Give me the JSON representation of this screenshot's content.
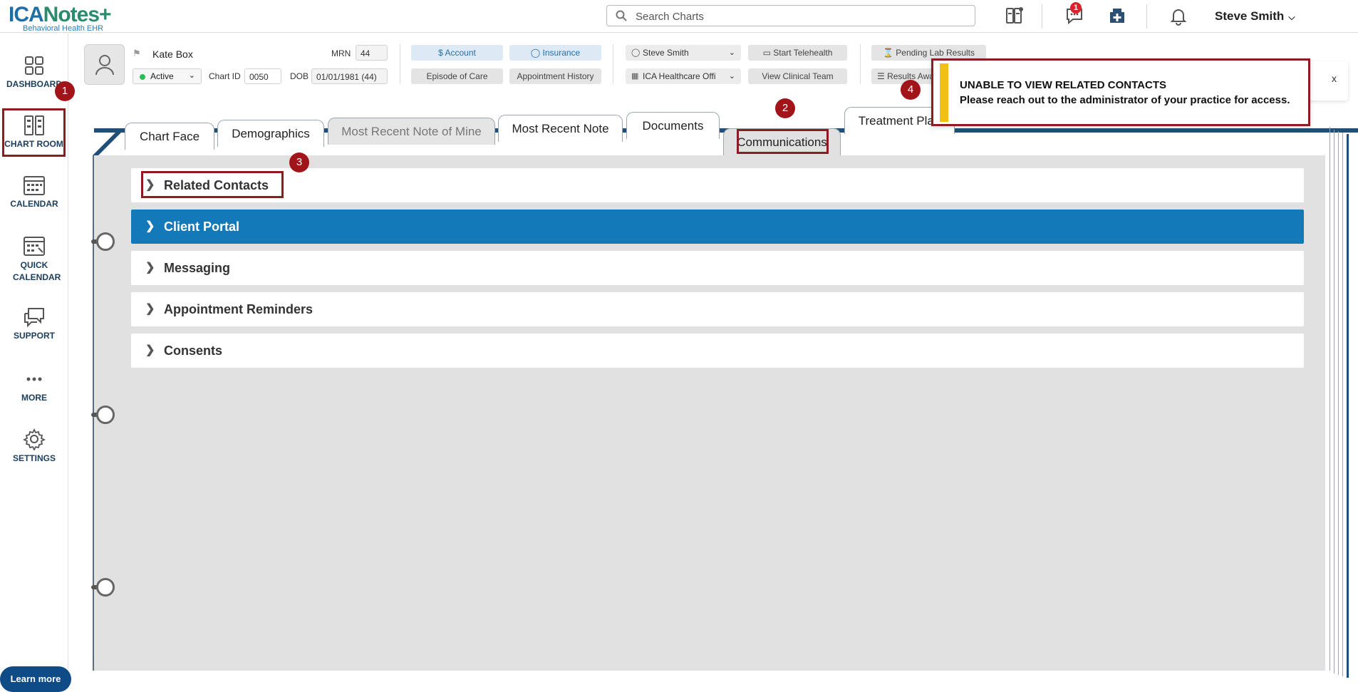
{
  "brand": {
    "logo_main": "ICA",
    "logo_notes": "Notes",
    "logo_sub": "Behavioral Health EHR"
  },
  "topbar": {
    "search_placeholder": "Search Charts",
    "notif_count": "1",
    "user_name": "Steve Smith"
  },
  "sidebar": {
    "items": [
      {
        "label": "DASHBOARD"
      },
      {
        "label": "CHART ROOM"
      },
      {
        "label": "CALENDAR"
      },
      {
        "label": "QUICK CALENDAR"
      },
      {
        "label": "SUPPORT"
      },
      {
        "label": "MORE"
      },
      {
        "label": "SETTINGS"
      }
    ],
    "learn_more": "Learn more"
  },
  "patient": {
    "name": "Kate Box",
    "status": "Active",
    "chart_id_label": "Chart ID",
    "chart_id": "0050",
    "mrn_label": "MRN",
    "mrn": "44",
    "dob_label": "DOB",
    "dob": "01/01/1981 (44)"
  },
  "header_buttons": {
    "account": "Account",
    "insurance": "Insurance",
    "episode": "Episode of Care",
    "appt_history": "Appointment History",
    "clinician": "Steve Smith",
    "location": "ICA Healthcare Offi",
    "telehealth": "Start Telehealth",
    "clinical_team": "View Clinical Team",
    "pending_lab": "Pending Lab Results",
    "results_awaiting": "Results Await"
  },
  "toast": {
    "title": "UNABLE TO VIEW RELATED CONTACTS",
    "message": "Please reach out to the administrator of your practice for access.",
    "close": "x"
  },
  "tabs": [
    {
      "label": "Chart Face"
    },
    {
      "label": "Demographics"
    },
    {
      "label": "Most Recent Note of Mine"
    },
    {
      "label": "Most Recent Note"
    },
    {
      "label": "Documents"
    },
    {
      "label": "Communications"
    },
    {
      "label": "Treatment Plan"
    }
  ],
  "sections": [
    {
      "label": "Related Contacts"
    },
    {
      "label": "Client Portal"
    },
    {
      "label": "Messaging"
    },
    {
      "label": "Appointment Reminders"
    },
    {
      "label": "Consents"
    }
  ],
  "callouts": [
    "1",
    "2",
    "3",
    "4"
  ],
  "colors": {
    "accent": "#1479b8",
    "highlight": "#8e1b1f",
    "warning": "#f2c012"
  }
}
